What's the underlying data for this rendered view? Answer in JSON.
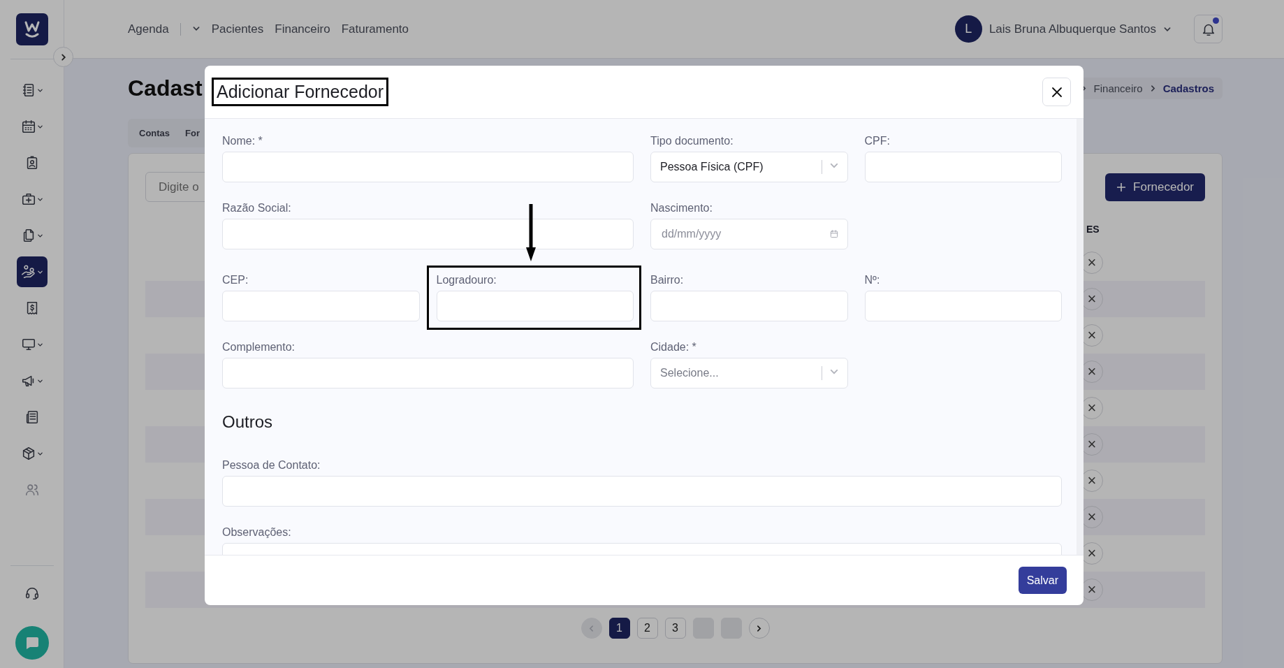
{
  "sidebar": {
    "items": [
      {
        "kind": "notebook",
        "expandable": true,
        "selected": false,
        "disabled": false
      },
      {
        "kind": "calendar",
        "expandable": true,
        "selected": false,
        "disabled": false
      },
      {
        "kind": "contact",
        "expandable": false,
        "selected": false,
        "disabled": false
      },
      {
        "kind": "medkit",
        "expandable": true,
        "selected": false,
        "disabled": false
      },
      {
        "kind": "documents",
        "expandable": true,
        "selected": false,
        "disabled": false
      },
      {
        "kind": "hand",
        "expandable": true,
        "selected": true,
        "disabled": false
      },
      {
        "kind": "receipt",
        "expandable": false,
        "selected": false,
        "disabled": false
      },
      {
        "kind": "monitor",
        "expandable": true,
        "selected": false,
        "disabled": false
      },
      {
        "kind": "megaphone",
        "expandable": true,
        "selected": false,
        "disabled": false
      },
      {
        "kind": "newspaper",
        "expandable": false,
        "selected": false,
        "disabled": false
      },
      {
        "kind": "box",
        "expandable": true,
        "selected": false,
        "disabled": false
      },
      {
        "kind": "users",
        "expandable": false,
        "selected": false,
        "disabled": true
      }
    ]
  },
  "topbar": {
    "nav": [
      {
        "label": "Agenda",
        "kind": "menu"
      },
      {
        "label": "Pacientes",
        "kind": "link"
      },
      {
        "label": "Financeiro",
        "kind": "link"
      },
      {
        "label": "Faturamento",
        "kind": "link"
      }
    ],
    "user": {
      "initial": "L",
      "name": "Lais Bruna Albuquerque Santos"
    },
    "notifications": {
      "unread": true
    }
  },
  "page": {
    "title": "Cadast",
    "breadcrumb": [
      {
        "label": "Financeiro",
        "current": false
      },
      {
        "label": "Cadastros",
        "current": true
      }
    ],
    "tabs": [
      "Contas",
      "For"
    ],
    "search": {
      "placeholder": "Digite o"
    },
    "add_button": "Fornecedor",
    "column_header": "ES",
    "rows": [
      {
        "remove": "×"
      },
      {
        "remove": "×"
      },
      {
        "remove": "×"
      },
      {
        "remove": "×"
      },
      {
        "remove": "×"
      },
      {
        "remove": "×"
      },
      {
        "remove": "×"
      },
      {
        "remove": "×"
      },
      {
        "remove": "×"
      },
      {
        "remove": "×"
      }
    ],
    "pagination": {
      "prev": {
        "disabled": true
      },
      "pages": [
        {
          "kind": "number",
          "label": "1",
          "selected": true
        },
        {
          "kind": "number",
          "label": "2",
          "selected": false
        },
        {
          "kind": "number",
          "label": "3",
          "selected": false
        },
        {
          "kind": "blank",
          "selected": false
        },
        {
          "kind": "blank",
          "selected": false
        }
      ],
      "next": {
        "disabled": false
      }
    }
  },
  "modal": {
    "title": "Adicionar Fornecedor",
    "title_highlighted": true,
    "fields": [
      {
        "label": "Nome: *",
        "kind": "text"
      },
      {
        "label": "Tipo documento:",
        "kind": "select",
        "value": "Pessoa Física (CPF)"
      },
      {
        "label": "CPF:",
        "kind": "text"
      },
      {
        "label": "Razão Social:",
        "kind": "text"
      },
      {
        "label": "Nascimento:",
        "kind": "date",
        "placeholder": "dd/mm/yyyy"
      },
      {
        "label": "CEP:",
        "kind": "text"
      },
      {
        "label": "Logradouro:",
        "kind": "text"
      },
      {
        "label": "Bairro:",
        "kind": "text"
      },
      {
        "label": "Nº:",
        "kind": "text"
      },
      {
        "label": "Complemento:",
        "kind": "text"
      },
      {
        "label": "Cidade: *",
        "kind": "select",
        "placeholder": "Selecione..."
      }
    ],
    "annotations": [
      {
        "kind": "box"
      },
      {
        "kind": "arrow"
      }
    ],
    "section": "Outros",
    "other_fields": [
      {
        "label": "Pessoa de Contato:"
      },
      {
        "label": "Observações:"
      }
    ],
    "save_button": "Salvar"
  }
}
